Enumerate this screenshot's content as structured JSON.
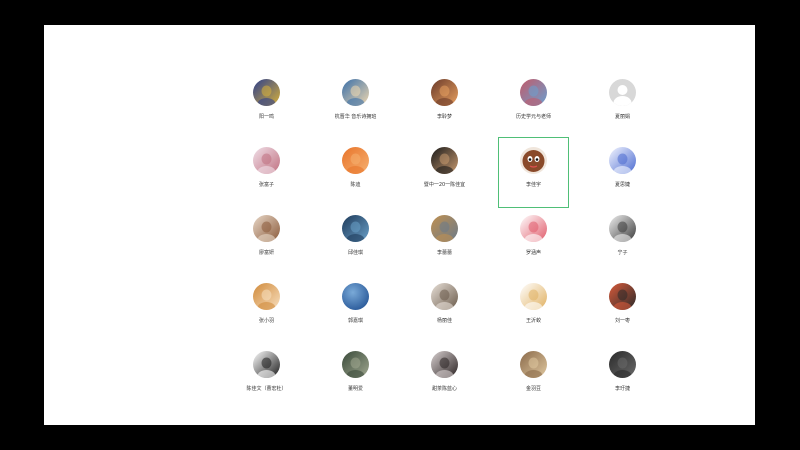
{
  "contacts": [
    {
      "name": "阳一鸣",
      "avatar": "gradient-avatar",
      "c1": "#2c3e8c",
      "c2": "#d9b23a"
    },
    {
      "name": "杭晋华 音乐诗拥班",
      "avatar": "cartoon-avatar",
      "c1": "#3a6fa8",
      "c2": "#f0d8b0"
    },
    {
      "name": "李聆梦",
      "avatar": "illustration-avatar",
      "c1": "#6a3a2a",
      "c2": "#e8a060"
    },
    {
      "name": "历史学元与老师",
      "avatar": "photo-avatar",
      "c1": "#c25a6a",
      "c2": "#6aa0d0"
    },
    {
      "name": "夏丽娟",
      "avatar": "default-avatar",
      "c1": "#d8d8d8",
      "c2": "#ffffff"
    },
    {
      "name": "张富子",
      "avatar": "sketch-avatar",
      "c1": "#f0e0e8",
      "c2": "#c07080"
    },
    {
      "name": "陈迪",
      "avatar": "orange-avatar",
      "c1": "#e8742a",
      "c2": "#f6b070"
    },
    {
      "name": "暨中一20一陈佳宜",
      "avatar": "portrait-avatar",
      "c1": "#1a1a1a",
      "c2": "#c89a70"
    },
    {
      "name": "李佳宇",
      "avatar": "face-avatar",
      "c1": "#8a4a2a",
      "c2": "#e0a070"
    },
    {
      "name": "夏思婕",
      "avatar": "pattern-avatar",
      "c1": "#f4f6ff",
      "c2": "#4a6ad0"
    },
    {
      "name": "廖富妍",
      "avatar": "pet-avatar",
      "c1": "#e8d8c8",
      "c2": "#8a5a3a"
    },
    {
      "name": "邱佳琪",
      "avatar": "blue-avatar",
      "c1": "#1e3a5a",
      "c2": "#6aa0c8"
    },
    {
      "name": "李蕾蕾",
      "avatar": "street-avatar",
      "c1": "#c09050",
      "c2": "#6a7a8a"
    },
    {
      "name": "罗涵声",
      "avatar": "pig-avatar",
      "c1": "#ffffff",
      "c2": "#e05a6a"
    },
    {
      "name": "宁子",
      "avatar": "bw-avatar",
      "c1": "#f0f0f0",
      "c2": "#3a3a3a"
    },
    {
      "name": "张小羽",
      "avatar": "dog-avatar",
      "c1": "#d08a3a",
      "c2": "#f8e0c0"
    },
    {
      "name": "郭嘉琪",
      "avatar": "sphere-avatar",
      "c1": "#2a5a9a",
      "c2": "#7aaad8"
    },
    {
      "name": "杨丽佳",
      "avatar": "anime-avatar",
      "c1": "#e8e0d8",
      "c2": "#6a5a4a"
    },
    {
      "name": "王沂蛟",
      "avatar": "doodle-avatar",
      "c1": "#ffffff",
      "c2": "#e0b060"
    },
    {
      "name": "刘一枣",
      "avatar": "glasses-avatar",
      "c1": "#d85a3a",
      "c2": "#2a2a2a"
    },
    {
      "name": "陈佳文（曹宏杜）",
      "avatar": "ink-avatar",
      "c1": "#ffffff",
      "c2": "#1a1a1a"
    },
    {
      "name": "董明爱",
      "avatar": "room-avatar",
      "c1": "#3a4a3a",
      "c2": "#a0a890"
    },
    {
      "name": "甜茶陈蓝心",
      "avatar": "girl-avatar",
      "c1": "#d8d0d0",
      "c2": "#2a2222"
    },
    {
      "name": "金羽豆",
      "avatar": "cafe-avatar",
      "c1": "#8a6a4a",
      "c2": "#e0c8a0"
    },
    {
      "name": "李玗捷",
      "avatar": "dark-avatar",
      "c1": "#2a2a2a",
      "c2": "#6a6a6a"
    }
  ],
  "selected_index": 8
}
